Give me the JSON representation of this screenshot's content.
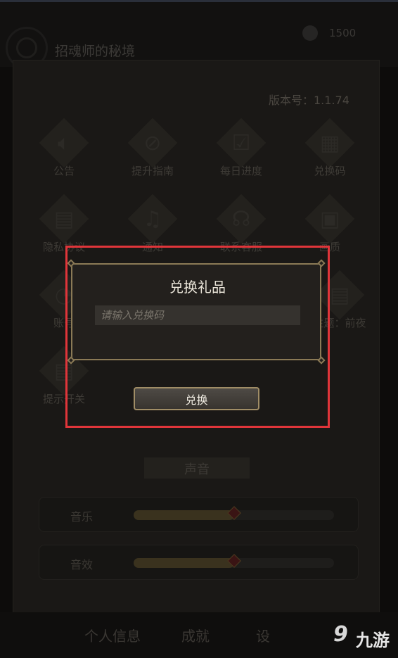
{
  "app": {
    "title": "招魂师的秘境",
    "coins": "1500"
  },
  "settings": {
    "version": "版本号：1.1.74",
    "grid": [
      {
        "label": "公告",
        "icon": "speaker-icon"
      },
      {
        "label": "提升指南",
        "icon": "compass-icon"
      },
      {
        "label": "每日进度",
        "icon": "calendar-check-icon"
      },
      {
        "label": "兑换码",
        "icon": "qr-code-icon"
      },
      {
        "label": "隐私协议",
        "icon": "document-icon"
      },
      {
        "label": "通知",
        "icon": "bell-icon"
      },
      {
        "label": "联系客服",
        "icon": "headset-icon"
      },
      {
        "label": "画质",
        "icon": "image-icon"
      },
      {
        "label": "账号",
        "icon": "account-icon"
      },
      {
        "label": "主题：前夜",
        "icon": "theme-icon"
      },
      {
        "label": "提示开关",
        "icon": "toggle-document-icon"
      }
    ],
    "sound": {
      "title": "声音",
      "music": {
        "label": "音乐",
        "level": 0.5
      },
      "effects": {
        "label": "音效",
        "level": 0.5
      }
    }
  },
  "tabs": [
    "个人信息",
    "成就",
    "设"
  ],
  "dialog": {
    "title": "兑换礼品",
    "input_placeholder": "请输入兑换码",
    "redeem_label": "兑换"
  },
  "watermark": {
    "glyph": "9",
    "text": "九游"
  },
  "colors": {
    "highlight": "#e0353a",
    "dialog_border": "#8b7a56"
  }
}
